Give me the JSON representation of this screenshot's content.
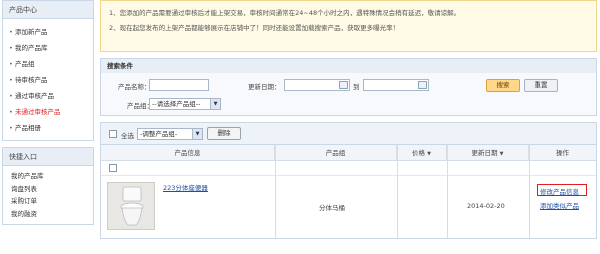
{
  "sidebar": {
    "product_center": {
      "title": "产品中心",
      "items": [
        {
          "label": "添加新产品",
          "active": false
        },
        {
          "label": "我的产品库",
          "active": false
        },
        {
          "label": "产品组",
          "active": false
        },
        {
          "label": "待审核产品",
          "active": false
        },
        {
          "label": "通过审核产品",
          "active": false
        },
        {
          "label": "未通过审核产品",
          "active": true
        },
        {
          "label": "产品相册",
          "active": false
        }
      ]
    },
    "quick_entry": {
      "title": "快捷入口",
      "items": [
        "我的产品库",
        "询盘列表",
        "采购订单",
        "我的融资"
      ]
    }
  },
  "notice": {
    "line1": "1、您添加的产品需要通过审核后才能上架交易，审核时间通常在24~48个小时之内，遇特殊情况会稍有延迟，敬请谅解。",
    "line2": "2、现在起您发布的上架产品都能够展示在店铺中了！同时还能设置加载搜索产品，获取更多曝光率！"
  },
  "search": {
    "title": "搜索条件",
    "name_label": "产品名称：",
    "name_value": "",
    "date_label": "更新日期：",
    "date_to": "到",
    "date_from_value": "",
    "date_to_value": "",
    "group_label": "产品组：",
    "group_select": "--请选择产品组--",
    "search_button": "搜索",
    "reset_button": "重置"
  },
  "table": {
    "select_all": "全选",
    "group_select": "-调整产品组-",
    "delete_button": "删除",
    "columns": [
      "产品信息",
      "产品组",
      "价格",
      "更新日期",
      "操作"
    ],
    "rows": [
      {
        "title": "223分体座便器",
        "group": "分体马桶",
        "price": "",
        "date": "2014-02-20",
        "actions": [
          "修改产品信息",
          "添加类似产品"
        ]
      }
    ]
  },
  "colors": {
    "active_menu": "#e02020",
    "link": "#1d4fa3",
    "notice_bg": "#fffbe6",
    "border": "#c9d7e6"
  }
}
